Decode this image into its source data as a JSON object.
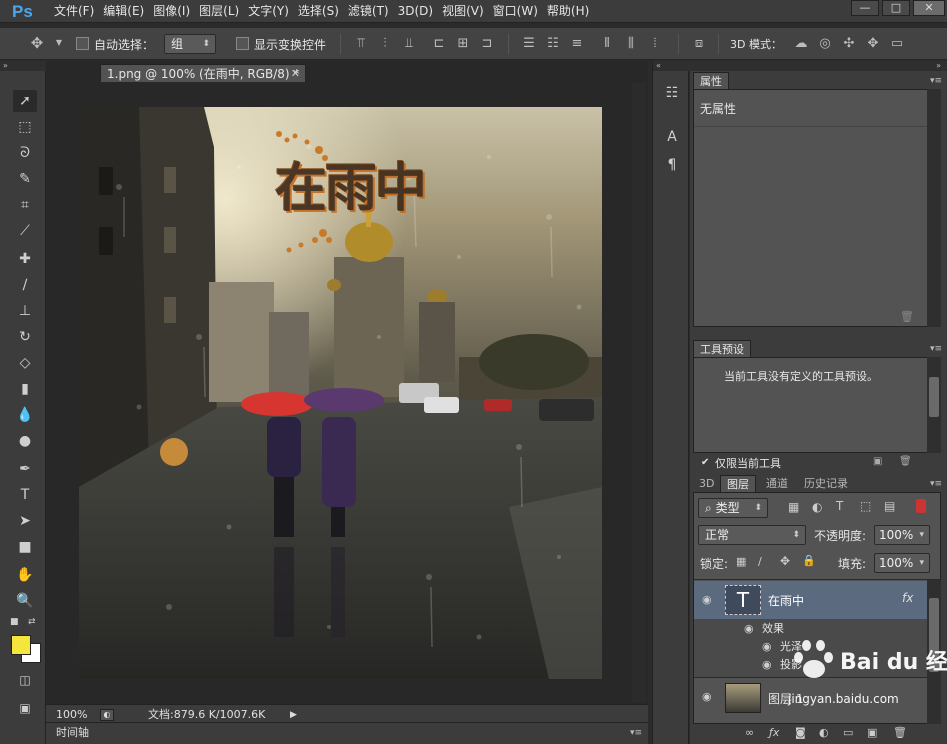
{
  "menubar": {
    "logo": "Ps",
    "items": [
      "文件(F)",
      "编辑(E)",
      "图像(I)",
      "图层(L)",
      "文字(Y)",
      "选择(S)",
      "滤镜(T)",
      "3D(D)",
      "视图(V)",
      "窗口(W)",
      "帮助(H)"
    ],
    "window_buttons": {
      "minimize": "—",
      "restore": "□",
      "close": "✕"
    }
  },
  "options": {
    "auto_select_label": "自动选择：",
    "auto_select_value": "组",
    "show_transform_label": "显示变换控件",
    "mode_3d_label": "3D 模式："
  },
  "document": {
    "tab_title": "1.png @ 100% (在雨中, RGB/8) *",
    "canvas_text": "在雨中",
    "zoom": "100%",
    "doc_info": "文档:879.6 K/1007.6K",
    "timeline_label": "时间轴"
  },
  "properties": {
    "tab": "属性",
    "body": "无属性"
  },
  "tool_presets": {
    "tab": "工具预设",
    "message": "当前工具没有定义的工具预设。",
    "current_only": "仅限当前工具"
  },
  "layers": {
    "tabs": [
      "3D",
      "图层",
      "通道",
      "历史记录"
    ],
    "filter_kind": "类型",
    "blend_mode": "正常",
    "opacity_label": "不透明度:",
    "opacity_value": "100%",
    "lock_label": "锁定:",
    "fill_label": "填充:",
    "fill_value": "100%",
    "rows": [
      {
        "name": "在雨中",
        "type": "T",
        "fx": "fx"
      },
      {
        "name": "效果"
      },
      {
        "name": "光泽"
      },
      {
        "name": "投影"
      },
      {
        "name": "图层 1"
      }
    ]
  },
  "watermark": {
    "brand": "Bai du 经验",
    "url": "jingyan.baidu.com"
  }
}
